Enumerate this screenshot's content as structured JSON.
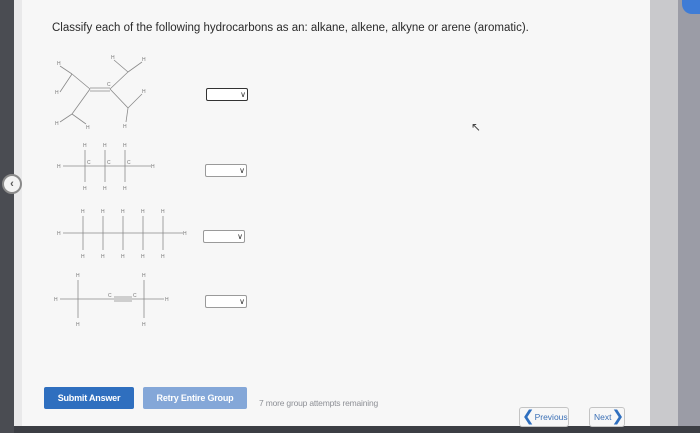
{
  "question": "Classify each of the following hydrocarbons as an: alkane, alkene, alkyne or arene (aromatic).",
  "atom_labels": {
    "hydrogen": "H",
    "carbon": "C"
  },
  "dropdowns": [
    {
      "selected": ""
    },
    {
      "selected": ""
    },
    {
      "selected": ""
    },
    {
      "selected": ""
    }
  ],
  "buttons": {
    "submit": "Submit Answer",
    "retry": "Retry Entire Group"
  },
  "attempts_text": "7 more group attempts remaining",
  "nav": {
    "previous": "Previous",
    "next": "Next"
  },
  "icons": {
    "dropdown": "chevron-down-icon",
    "prev": "chevron-left-icon",
    "next": "chevron-right-icon",
    "back": "back-arrow-icon",
    "cursor": "mouse-cursor-icon"
  },
  "colors": {
    "primary": "#2f6fbf",
    "secondary": "#84a7d8",
    "left_bar": "#4a4c52"
  }
}
